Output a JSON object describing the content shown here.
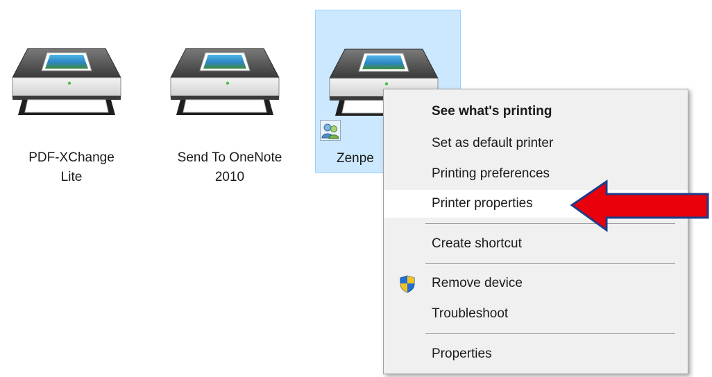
{
  "printers": [
    {
      "label_line1": "PDF-XChange",
      "label_line2": "Lite",
      "selected": false,
      "icon": "printer-icon"
    },
    {
      "label_line1": "Send To OneNote",
      "label_line2": "2010",
      "selected": false,
      "icon": "printer-icon"
    },
    {
      "label_line1": "Zenpe",
      "label_line2": "",
      "selected": true,
      "icon": "printer-icon",
      "badge_icon": "shared-users-icon"
    }
  ],
  "context_menu": {
    "items": [
      {
        "label": "See what's printing",
        "bold": true
      },
      {
        "label": "Set as default printer"
      },
      {
        "label": "Printing preferences"
      },
      {
        "label": "Printer properties",
        "highlighted": true
      },
      {
        "label": "Create shortcut"
      },
      {
        "label": "Remove device",
        "icon": "uac-shield-icon"
      },
      {
        "label": "Troubleshoot"
      },
      {
        "label": "Properties"
      }
    ]
  },
  "annotation": {
    "icon": "red-arrow-icon",
    "fill_color": "#e8000b",
    "outline_color": "#1f3c88"
  },
  "colors": {
    "selection_fill": "#cce8ff",
    "selection_border": "#99d1ff",
    "menu_background": "#f0f0f0",
    "menu_highlight": "#ffffff"
  }
}
